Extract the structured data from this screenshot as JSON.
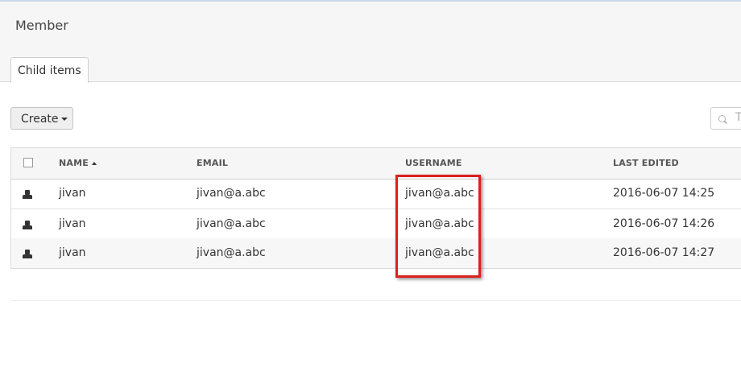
{
  "header": {
    "title": "Member"
  },
  "tabs": [
    {
      "label": "Child items"
    }
  ],
  "toolbar": {
    "create_label": "Create",
    "search_placeholder": "T"
  },
  "table": {
    "columns": [
      {
        "label": "NAME",
        "sort": "ascending"
      },
      {
        "label": "EMAIL"
      },
      {
        "label": "USERNAME"
      },
      {
        "label": "LAST EDITED"
      }
    ],
    "rows": [
      {
        "icon": "user-icon",
        "name": "jivan",
        "email": "jivan@a.abc",
        "username": "jivan@a.abc",
        "last_edited": "2016-06-07 14:25"
      },
      {
        "icon": "user-icon",
        "name": "jivan",
        "email": "jivan@a.abc",
        "username": "jivan@a.abc",
        "last_edited": "2016-06-07 14:26"
      },
      {
        "icon": "user-icon",
        "name": "jivan",
        "email": "jivan@a.abc",
        "username": "jivan@a.abc",
        "last_edited": "2016-06-07 14:27"
      }
    ]
  },
  "annotation": {
    "type": "highlight-box",
    "color": "#dc1f1f",
    "target_column": "USERNAME"
  }
}
